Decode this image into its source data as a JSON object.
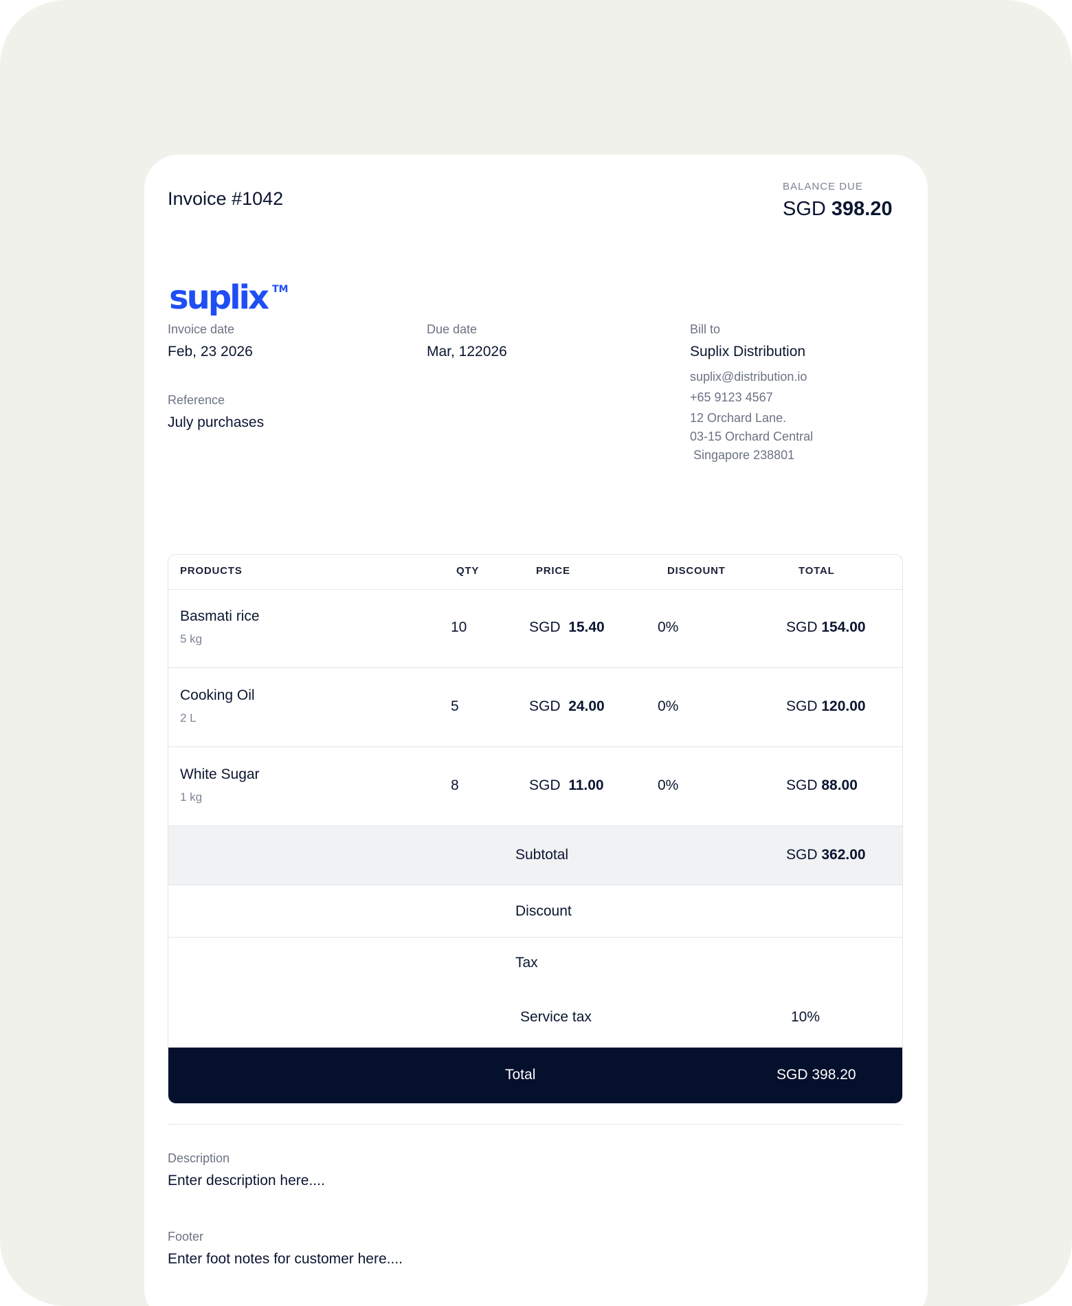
{
  "invoice": {
    "title": "Invoice #1042",
    "balance_label": "BALANCE DUE",
    "balance_currency": "SGD",
    "balance_amount": "398.20"
  },
  "brand": {
    "logo_text": "suplix",
    "logo_mark": "TM",
    "color": "#1f4ef5"
  },
  "details": {
    "invoice_date_label": "Invoice date",
    "invoice_date": "Feb, 23 2026",
    "due_date_label": "Due date",
    "due_date": "Mar, 122026",
    "reference_label": "Reference",
    "reference": "July purchases",
    "bill_to_label": "Bill to",
    "bill_to_name": "Suplix Distribution",
    "email": "suplix@distribution.io",
    "phone": "+65 9123 4567",
    "address_1": "12 Orchard Lane.",
    "address_2": "03-15 Orchard Central",
    "address_3": " Singapore 238801"
  },
  "table": {
    "headers": {
      "products": "PRODUCTS",
      "qty": "QTY",
      "price": "PRICE",
      "discount": "DISCOUNT",
      "total": "TOTAL"
    },
    "currency": "SGD",
    "rows": [
      {
        "name": "Basmati rice",
        "unit": "5 kg",
        "qty": "10",
        "price": "15.40",
        "discount": "0%",
        "total": "154.00"
      },
      {
        "name": "Cooking Oil",
        "unit": "2 L",
        "qty": "5",
        "price": "24.00",
        "discount": "0%",
        "total": "120.00"
      },
      {
        "name": "White Sugar",
        "unit": "1 kg",
        "qty": "8",
        "price": "11.00",
        "discount": "0%",
        "total": "88.00"
      }
    ]
  },
  "summary": {
    "subtotal_label": "Subtotal",
    "subtotal_amount": "362.00",
    "discount_label": "Discount",
    "tax_label": "Tax",
    "service_tax_label": "Service tax",
    "service_tax_value": "10%",
    "total_label": "Total",
    "total_value": "SGD 398.20"
  },
  "notes": {
    "description_label": "Description",
    "description_value": "Enter description here....",
    "footer_label": "Footer",
    "footer_value": "Enter foot notes for customer here...."
  },
  "colors": {
    "page_bg": "#f1f1ec",
    "card_bg": "#ffffff",
    "total_bar": "#05102d",
    "subtotal_bg": "#f1f2f4"
  }
}
